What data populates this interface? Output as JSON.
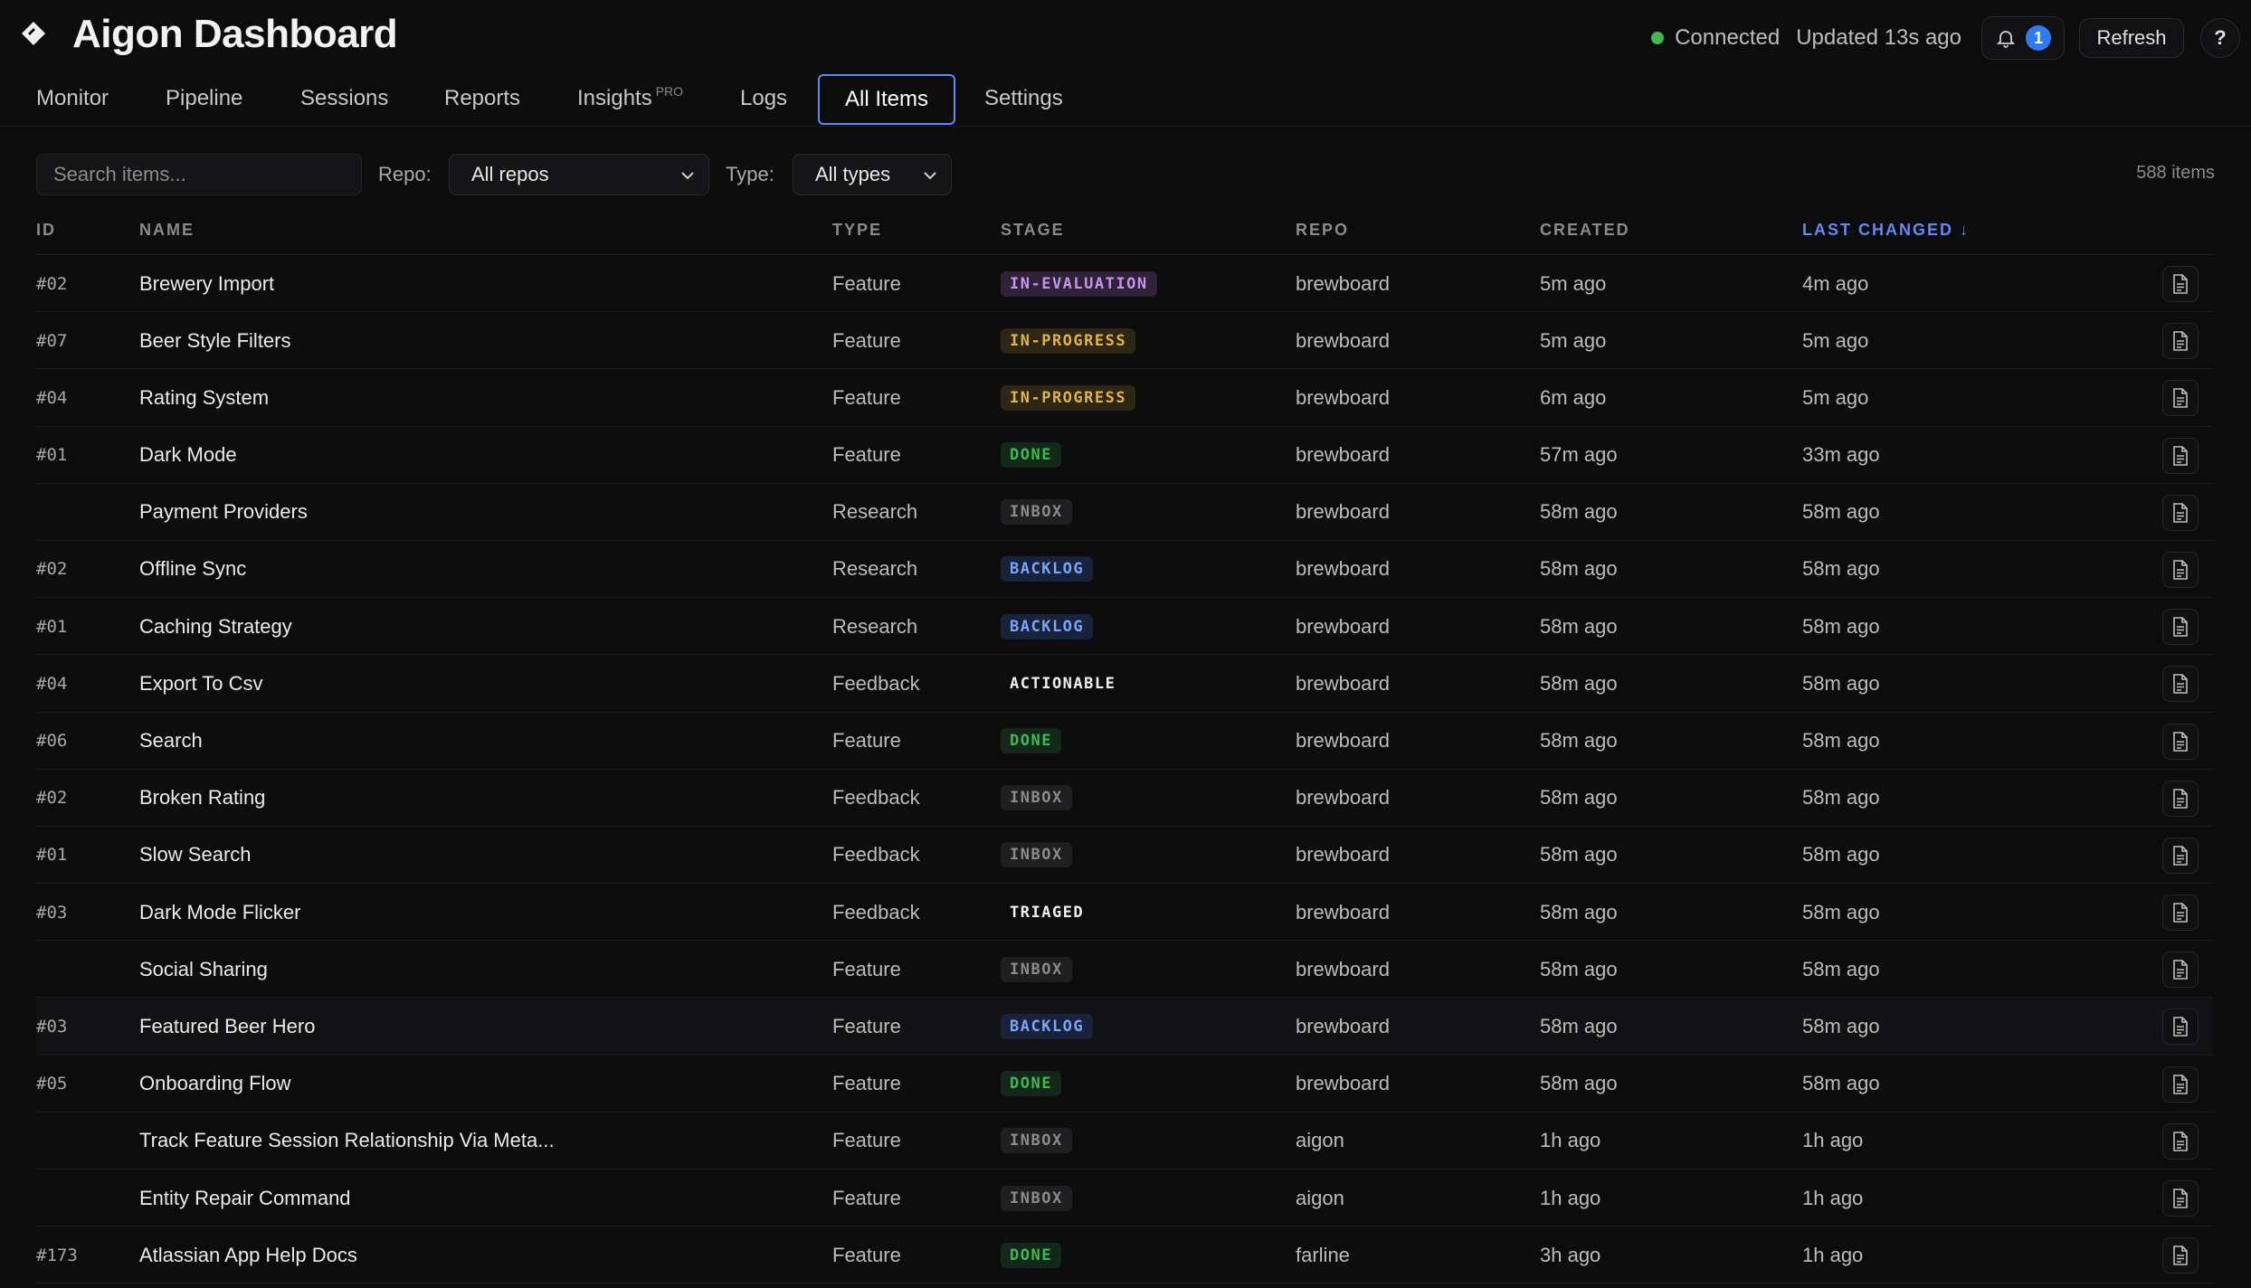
{
  "header": {
    "title": "Aigon Dashboard",
    "connection": "Connected",
    "updated": "Updated 13s ago",
    "notification_count": "1",
    "refresh_label": "Refresh",
    "help_label": "?"
  },
  "nav": {
    "tabs": [
      {
        "label": "Monitor"
      },
      {
        "label": "Pipeline"
      },
      {
        "label": "Sessions"
      },
      {
        "label": "Reports"
      },
      {
        "label": "Insights",
        "sup": "PRO"
      },
      {
        "label": "Logs"
      },
      {
        "label": "All Items",
        "active": true
      },
      {
        "label": "Settings"
      }
    ]
  },
  "filters": {
    "search_placeholder": "Search items...",
    "repo_label": "Repo:",
    "repo_value": "All repos",
    "type_label": "Type:",
    "type_value": "All types",
    "count": "588 items"
  },
  "table": {
    "columns": [
      "ID",
      "NAME",
      "TYPE",
      "STAGE",
      "REPO",
      "CREATED",
      "LAST CHANGED ↓"
    ],
    "sorted_column": "LAST CHANGED ↓",
    "rows": [
      {
        "id": "#02",
        "name": "Brewery Import",
        "type": "Feature",
        "stage": "IN-EVALUATION",
        "repo": "brewboard",
        "created": "5m ago",
        "changed": "4m ago"
      },
      {
        "id": "#07",
        "name": "Beer Style Filters",
        "type": "Feature",
        "stage": "IN-PROGRESS",
        "repo": "brewboard",
        "created": "5m ago",
        "changed": "5m ago"
      },
      {
        "id": "#04",
        "name": "Rating System",
        "type": "Feature",
        "stage": "IN-PROGRESS",
        "repo": "brewboard",
        "created": "6m ago",
        "changed": "5m ago"
      },
      {
        "id": "#01",
        "name": "Dark Mode",
        "type": "Feature",
        "stage": "DONE",
        "repo": "brewboard",
        "created": "57m ago",
        "changed": "33m ago"
      },
      {
        "id": "",
        "name": "Payment Providers",
        "type": "Research",
        "stage": "INBOX",
        "repo": "brewboard",
        "created": "58m ago",
        "changed": "58m ago"
      },
      {
        "id": "#02",
        "name": "Offline Sync",
        "type": "Research",
        "stage": "BACKLOG",
        "repo": "brewboard",
        "created": "58m ago",
        "changed": "58m ago"
      },
      {
        "id": "#01",
        "name": "Caching Strategy",
        "type": "Research",
        "stage": "BACKLOG",
        "repo": "brewboard",
        "created": "58m ago",
        "changed": "58m ago"
      },
      {
        "id": "#04",
        "name": "Export To Csv",
        "type": "Feedback",
        "stage": "ACTIONABLE",
        "repo": "brewboard",
        "created": "58m ago",
        "changed": "58m ago"
      },
      {
        "id": "#06",
        "name": "Search",
        "type": "Feature",
        "stage": "DONE",
        "repo": "brewboard",
        "created": "58m ago",
        "changed": "58m ago"
      },
      {
        "id": "#02",
        "name": "Broken Rating",
        "type": "Feedback",
        "stage": "INBOX",
        "repo": "brewboard",
        "created": "58m ago",
        "changed": "58m ago"
      },
      {
        "id": "#01",
        "name": "Slow Search",
        "type": "Feedback",
        "stage": "INBOX",
        "repo": "brewboard",
        "created": "58m ago",
        "changed": "58m ago"
      },
      {
        "id": "#03",
        "name": "Dark Mode Flicker",
        "type": "Feedback",
        "stage": "TRIAGED",
        "repo": "brewboard",
        "created": "58m ago",
        "changed": "58m ago"
      },
      {
        "id": "",
        "name": "Social Sharing",
        "type": "Feature",
        "stage": "INBOX",
        "repo": "brewboard",
        "created": "58m ago",
        "changed": "58m ago"
      },
      {
        "id": "#03",
        "name": "Featured Beer Hero",
        "type": "Feature",
        "stage": "BACKLOG",
        "repo": "brewboard",
        "created": "58m ago",
        "changed": "58m ago",
        "highlight": true
      },
      {
        "id": "#05",
        "name": "Onboarding Flow",
        "type": "Feature",
        "stage": "DONE",
        "repo": "brewboard",
        "created": "58m ago",
        "changed": "58m ago"
      },
      {
        "id": "",
        "name": "Track Feature Session Relationship Via Meta...",
        "type": "Feature",
        "stage": "INBOX",
        "repo": "aigon",
        "created": "1h ago",
        "changed": "1h ago"
      },
      {
        "id": "",
        "name": "Entity Repair Command",
        "type": "Feature",
        "stage": "INBOX",
        "repo": "aigon",
        "created": "1h ago",
        "changed": "1h ago"
      },
      {
        "id": "#173",
        "name": "Atlassian App Help Docs",
        "type": "Feature",
        "stage": "DONE",
        "repo": "farline",
        "created": "3h ago",
        "changed": "1h ago"
      }
    ]
  },
  "stage_colors": {
    "IN-EVALUATION": {
      "fg": "#c792ea",
      "bg": "#2d2238"
    },
    "IN-PROGRESS": {
      "fg": "#e3b341",
      "bg": "#2e2614"
    },
    "DONE": {
      "fg": "#3fb950",
      "bg": "#13281a"
    },
    "INBOX": {
      "fg": "#8b8b8b",
      "bg": "#1f1f22"
    },
    "BACKLOG": {
      "fg": "#79a6f6",
      "bg": "#18223a"
    },
    "ACTIONABLE": {
      "fg": "#f0f0f0",
      "bg": "transparent"
    },
    "TRIAGED": {
      "fg": "#f0f0f0",
      "bg": "transparent"
    }
  },
  "icons": {
    "logo": "diamond-logo-icon",
    "bell": "bell-icon",
    "chevron": "chevron-down-icon",
    "row_action": "document-icon"
  }
}
